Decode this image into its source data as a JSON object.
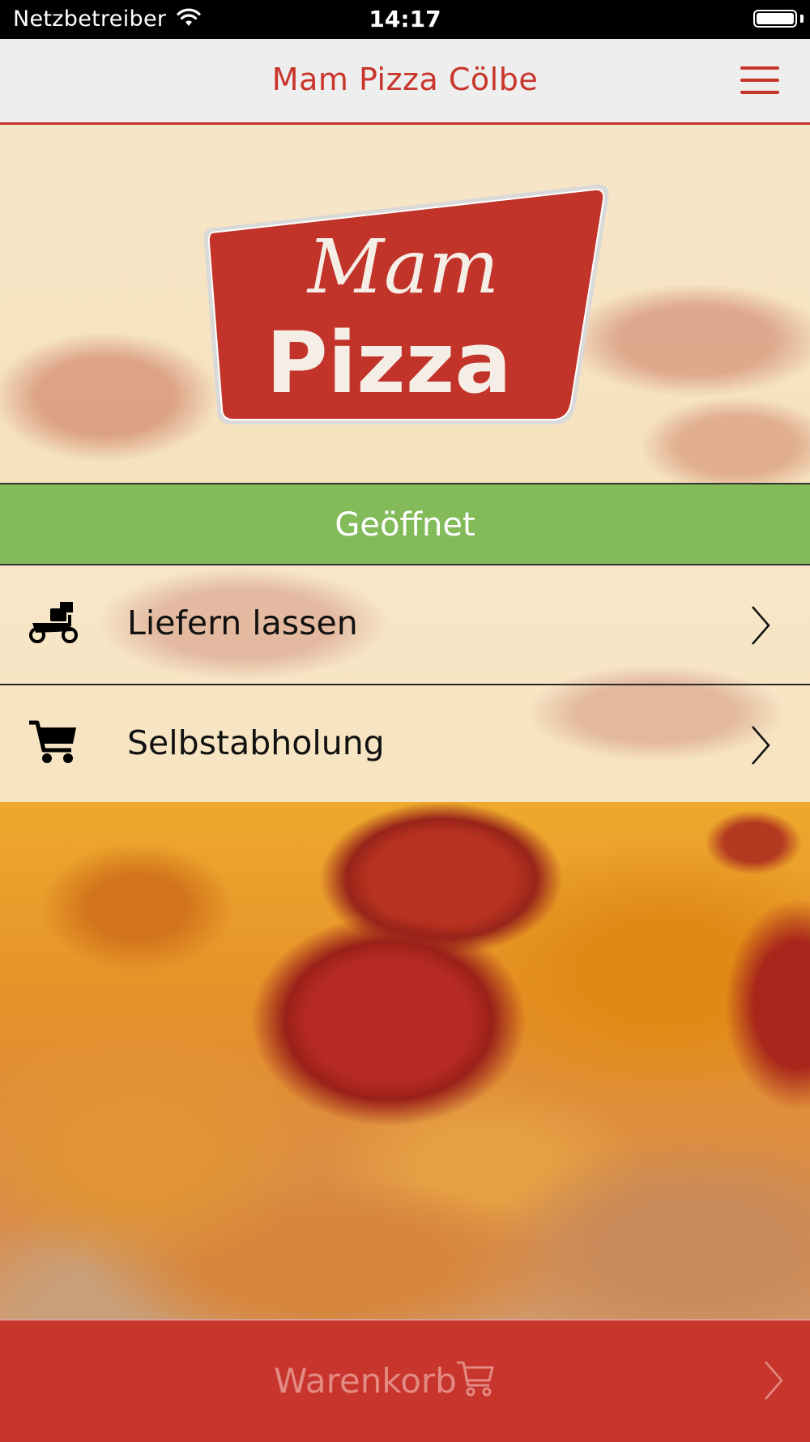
{
  "status_bar": {
    "carrier": "Netzbetreiber",
    "time": "14:17"
  },
  "header": {
    "title": "Mam Pizza Cölbe"
  },
  "logo": {
    "line1": "Mam",
    "line2": "Pizza"
  },
  "open_status": {
    "label": "Geöffnet",
    "color": "#83bb5b"
  },
  "options": [
    {
      "label": "Liefern lassen",
      "icon": "delivery-scooter-icon"
    },
    {
      "label": "Selbstabholung",
      "icon": "shopping-cart-icon"
    }
  ],
  "cart": {
    "label": "Warenkorb",
    "icon": "shopping-cart-icon"
  },
  "colors": {
    "brand_red": "#c8352b",
    "nav_background": "#eeeeee",
    "open_green": "#83bb5b"
  }
}
